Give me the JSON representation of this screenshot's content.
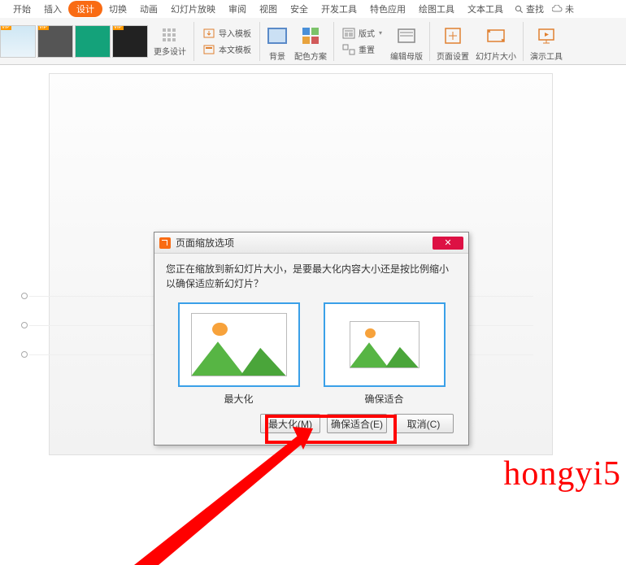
{
  "menu": {
    "items": [
      "开始",
      "插入",
      "设计",
      "切换",
      "动画",
      "幻灯片放映",
      "审阅",
      "视图",
      "安全",
      "开发工具",
      "特色应用",
      "绘图工具",
      "文本工具"
    ],
    "active_index": 2,
    "find": "查找",
    "cloud_tail": "未"
  },
  "ribbon": {
    "more_design": "更多设计",
    "import_tpl": "导入模板",
    "this_tpl": "本文模板",
    "background": "背景",
    "color_scheme": "配色方案",
    "layout": "版式",
    "reset": "重置",
    "edit_master": "编辑母版",
    "page_setup": "页面设置",
    "slide_size": "幻灯片大小",
    "present_tools": "演示工具"
  },
  "dialog": {
    "title": "页面缩放选项",
    "message": "您正在缩放到新幻灯片大小，是要最大化内容大小还是按比例缩小以确保适应新幻灯片？",
    "opt_max": "最大化",
    "opt_fit": "确保适合",
    "btn_max": "最大化(M)",
    "btn_fit": "确保适合(E)",
    "btn_cancel": "取消(C)"
  },
  "watermark": "hongyi5"
}
